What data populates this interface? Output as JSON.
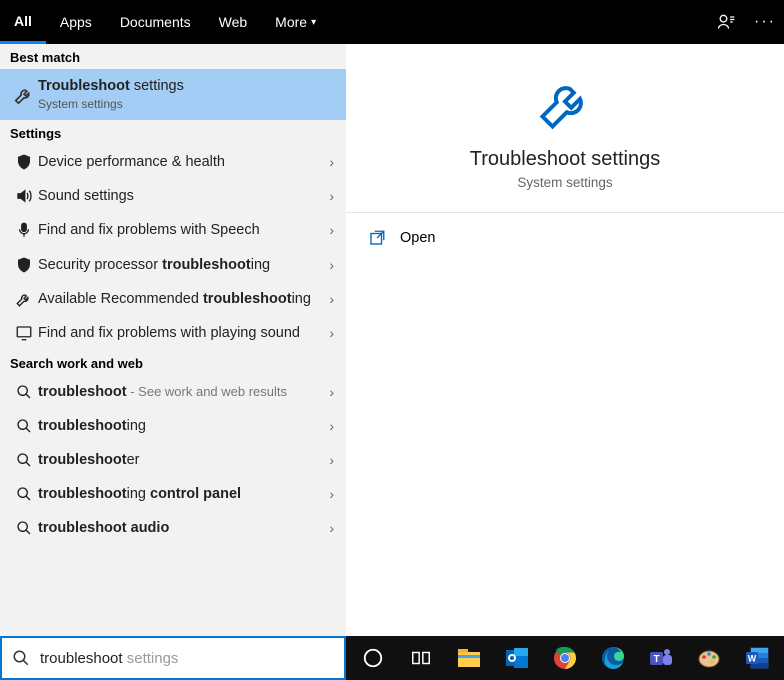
{
  "tabs": {
    "all": "All",
    "apps": "Apps",
    "documents": "Documents",
    "web": "Web",
    "more": "More"
  },
  "groups": {
    "best": "Best match",
    "settings": "Settings",
    "web": "Search work and web"
  },
  "best": {
    "title_bold": "Troubleshoot",
    "title_rest": " settings",
    "sub": "System settings"
  },
  "settings_list": [
    {
      "label": "Device performance & health",
      "icon": "shield"
    },
    {
      "label": "Sound settings",
      "icon": "sound"
    },
    {
      "label": "Find and fix problems with Speech",
      "icon": "mic"
    },
    {
      "label_pre": "Security processor ",
      "label_bold": "troubleshoot",
      "label_post": "ing",
      "icon": "shield"
    },
    {
      "label_pre": "Available Recommended ",
      "label_bold": "troubleshoot",
      "label_post": "ing",
      "icon": "wrench"
    },
    {
      "label": "Find and fix problems with playing sound",
      "icon": "monitor"
    }
  ],
  "web_list": [
    {
      "bold": "troubleshoot",
      "rest": "",
      "hint": " - See work and web results"
    },
    {
      "bold": "troubleshoot",
      "rest": "ing",
      "hint": ""
    },
    {
      "bold": "troubleshoot",
      "rest": "er",
      "hint": ""
    },
    {
      "bold": "troubleshoot",
      "rest": "ing ",
      "bold2": "control panel",
      "hint": ""
    },
    {
      "bold": "troubleshoot",
      "rest": " ",
      "bold2": "audio",
      "hint": ""
    }
  ],
  "detail": {
    "title": "Troubleshoot settings",
    "sub": "System settings",
    "open": "Open"
  },
  "search": {
    "typed": "troubleshoot",
    "suggestion": " settings"
  }
}
